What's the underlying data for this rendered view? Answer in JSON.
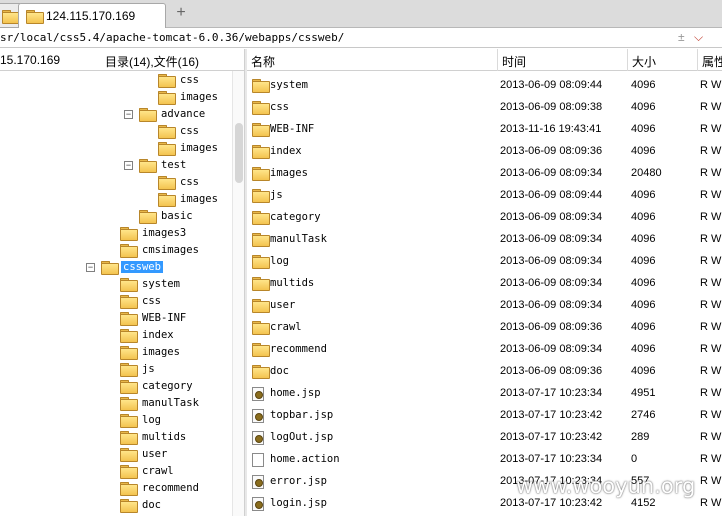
{
  "tab": {
    "title": "124.115.170.169"
  },
  "path": {
    "text": "sr/local/css5.4/apache-tomcat-6.0.36/webapps/cssweb/",
    "btn_plus": "±",
    "btn_down": "⌵"
  },
  "header": {
    "host": "15.170.169",
    "tree_summary": "目录(14),文件(16)",
    "col_name": "名称",
    "col_time": "时间",
    "col_size": "大小",
    "col_attr": "属性"
  },
  "tree": [
    {
      "label": "css",
      "level": 3,
      "expander": ""
    },
    {
      "label": "images",
      "level": 3,
      "expander": ""
    },
    {
      "label": "advance",
      "level": 2,
      "expander": "−"
    },
    {
      "label": "css",
      "level": 3,
      "expander": ""
    },
    {
      "label": "images",
      "level": 3,
      "expander": ""
    },
    {
      "label": "test",
      "level": 2,
      "expander": "−"
    },
    {
      "label": "css",
      "level": 3,
      "expander": ""
    },
    {
      "label": "images",
      "level": 3,
      "expander": ""
    },
    {
      "label": "basic",
      "level": 2,
      "expander": ""
    },
    {
      "label": "images3",
      "level": 1,
      "expander": ""
    },
    {
      "label": "cmsimages",
      "level": 1,
      "expander": ""
    },
    {
      "label": "cssweb",
      "level": 0,
      "expander": "−",
      "selected": true
    },
    {
      "label": "system",
      "level": 1,
      "expander": ""
    },
    {
      "label": "css",
      "level": 1,
      "expander": ""
    },
    {
      "label": "WEB-INF",
      "level": 1,
      "expander": ""
    },
    {
      "label": "index",
      "level": 1,
      "expander": ""
    },
    {
      "label": "images",
      "level": 1,
      "expander": ""
    },
    {
      "label": "js",
      "level": 1,
      "expander": ""
    },
    {
      "label": "category",
      "level": 1,
      "expander": ""
    },
    {
      "label": "manulTask",
      "level": 1,
      "expander": ""
    },
    {
      "label": "log",
      "level": 1,
      "expander": ""
    },
    {
      "label": "multids",
      "level": 1,
      "expander": ""
    },
    {
      "label": "user",
      "level": 1,
      "expander": ""
    },
    {
      "label": "crawl",
      "level": 1,
      "expander": ""
    },
    {
      "label": "recommend",
      "level": 1,
      "expander": ""
    },
    {
      "label": "doc",
      "level": 1,
      "expander": ""
    }
  ],
  "files": [
    {
      "name": "system",
      "time": "2013-06-09 08:09:44",
      "size": "4096",
      "attr": "R W",
      "type": "folder"
    },
    {
      "name": "css",
      "time": "2013-06-09 08:09:38",
      "size": "4096",
      "attr": "R W",
      "type": "folder"
    },
    {
      "name": "WEB-INF",
      "time": "2013-11-16 19:43:41",
      "size": "4096",
      "attr": "R W",
      "type": "folder"
    },
    {
      "name": "index",
      "time": "2013-06-09 08:09:36",
      "size": "4096",
      "attr": "R W",
      "type": "folder"
    },
    {
      "name": "images",
      "time": "2013-06-09 08:09:34",
      "size": "20480",
      "attr": "R W",
      "type": "folder"
    },
    {
      "name": "js",
      "time": "2013-06-09 08:09:44",
      "size": "4096",
      "attr": "R W",
      "type": "folder"
    },
    {
      "name": "category",
      "time": "2013-06-09 08:09:34",
      "size": "4096",
      "attr": "R W",
      "type": "folder"
    },
    {
      "name": "manulTask",
      "time": "2013-06-09 08:09:34",
      "size": "4096",
      "attr": "R W",
      "type": "folder"
    },
    {
      "name": "log",
      "time": "2013-06-09 08:09:34",
      "size": "4096",
      "attr": "R W",
      "type": "folder"
    },
    {
      "name": "multids",
      "time": "2013-06-09 08:09:34",
      "size": "4096",
      "attr": "R W",
      "type": "folder"
    },
    {
      "name": "user",
      "time": "2013-06-09 08:09:34",
      "size": "4096",
      "attr": "R W",
      "type": "folder"
    },
    {
      "name": "crawl",
      "time": "2013-06-09 08:09:36",
      "size": "4096",
      "attr": "R W",
      "type": "folder"
    },
    {
      "name": "recommend",
      "time": "2013-06-09 08:09:34",
      "size": "4096",
      "attr": "R W",
      "type": "folder"
    },
    {
      "name": "doc",
      "time": "2013-06-09 08:09:36",
      "size": "4096",
      "attr": "R W",
      "type": "folder"
    },
    {
      "name": "home.jsp",
      "time": "2013-07-17 10:23:34",
      "size": "4951",
      "attr": "R W",
      "type": "jsp"
    },
    {
      "name": "topbar.jsp",
      "time": "2013-07-17 10:23:42",
      "size": "2746",
      "attr": "R W",
      "type": "jsp"
    },
    {
      "name": "logOut.jsp",
      "time": "2013-07-17 10:23:42",
      "size": "289",
      "attr": "R W",
      "type": "jsp"
    },
    {
      "name": "home.action",
      "time": "2013-07-17 10:23:34",
      "size": "0",
      "attr": "R W",
      "type": "doc"
    },
    {
      "name": "error.jsp",
      "time": "2013-07-17 10:23:34",
      "size": "557",
      "attr": "R W",
      "type": "jsp"
    },
    {
      "name": "login.jsp",
      "time": "2013-07-17 10:23:42",
      "size": "4152",
      "attr": "R W",
      "type": "jsp"
    }
  ],
  "watermark": "www.wooyun.org"
}
